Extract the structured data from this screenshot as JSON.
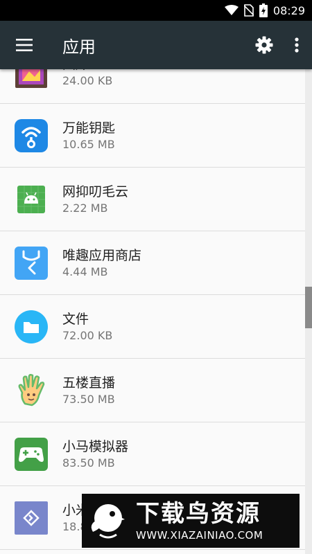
{
  "status_bar": {
    "time": "08:29"
  },
  "app_bar": {
    "title": "应用"
  },
  "apps": [
    {
      "name": "图库",
      "size": "24.00 KB",
      "icon": "gallery-icon"
    },
    {
      "name": "万能钥匙",
      "size": "10.65 MB",
      "icon": "wifi-key-icon"
    },
    {
      "name": "网抑叨毛云",
      "size": "2.22 MB",
      "icon": "android-icon"
    },
    {
      "name": "唯趣应用商店",
      "size": "4.44 MB",
      "icon": "store-bag-icon"
    },
    {
      "name": "文件",
      "size": "72.00 KB",
      "icon": "folder-icon"
    },
    {
      "name": "五楼直播",
      "size": "73.50 MB",
      "icon": "hand-icon"
    },
    {
      "name": "小马模拟器",
      "size": "83.50 MB",
      "icon": "gamepad-icon"
    },
    {
      "name": "小米",
      "size": "18.8",
      "icon": "diamond-arrow-icon"
    }
  ],
  "watermark": {
    "title": "下载鸟资源",
    "url": "WWW.XIAZAINIAO.COM"
  },
  "colors": {
    "app_bar": "#263238",
    "status_bar": "#000000",
    "background": "#fafafa"
  }
}
